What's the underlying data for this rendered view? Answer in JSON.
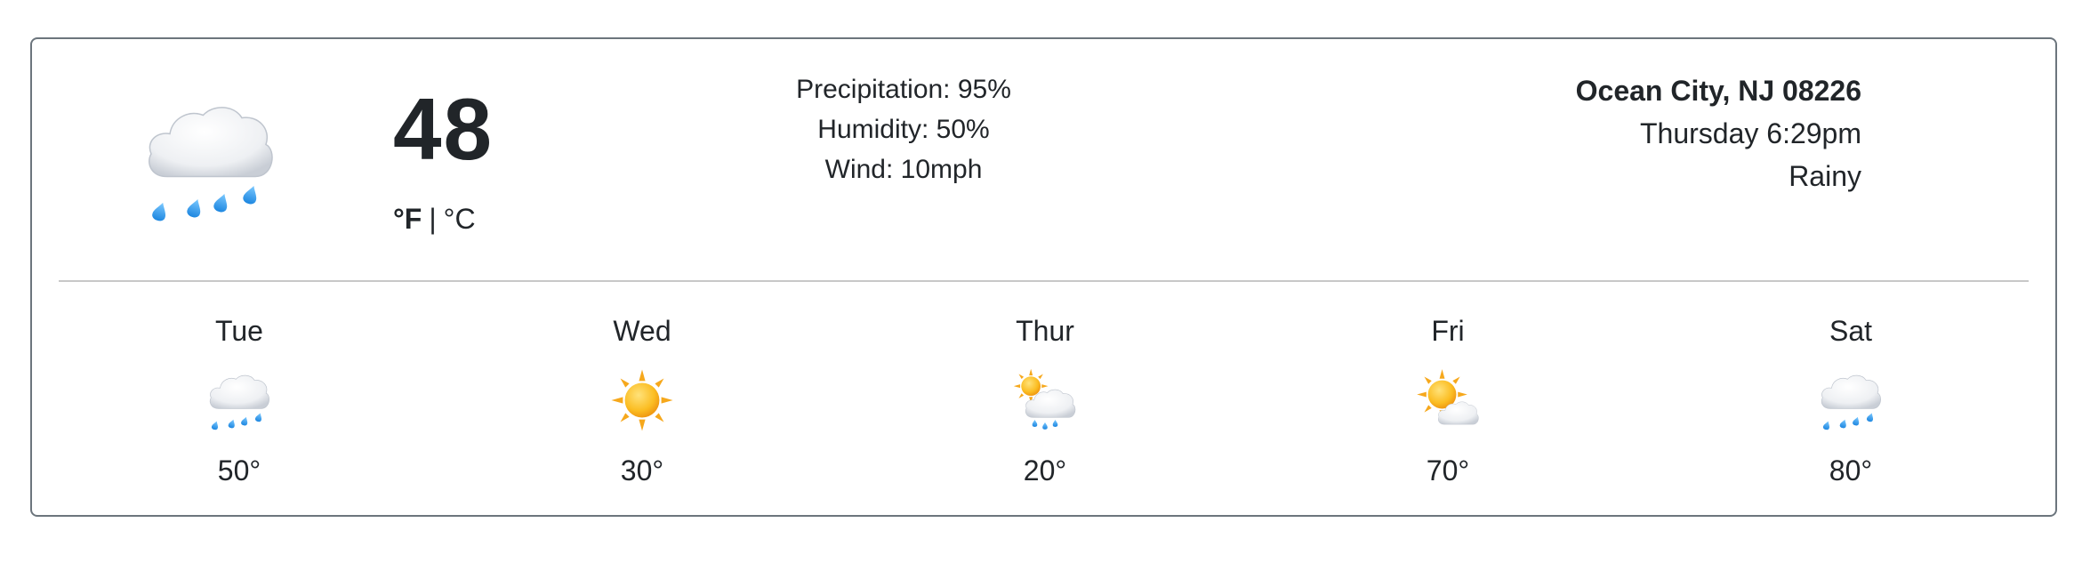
{
  "current": {
    "icon": "cloud-rain-icon",
    "temperature": "48",
    "unit_f": "°F",
    "unit_separator": "|",
    "unit_c": "°C",
    "precipitation": "Precipitation: 95%",
    "humidity": "Humidity: 50%",
    "wind": "Wind: 10mph",
    "location": "Ocean City, NJ 08226",
    "datetime": "Thursday 6:29pm",
    "condition": "Rainy"
  },
  "forecast": [
    {
      "day": "Tue",
      "icon": "cloud-rain-icon",
      "temp": "50°"
    },
    {
      "day": "Wed",
      "icon": "sun-icon",
      "temp": "30°"
    },
    {
      "day": "Thur",
      "icon": "sun-cloud-rain-icon",
      "temp": "20°"
    },
    {
      "day": "Fri",
      "icon": "sun-behind-cloud-icon",
      "temp": "70°"
    },
    {
      "day": "Sat",
      "icon": "cloud-rain-icon",
      "temp": "80°"
    }
  ],
  "colors": {
    "border": "#6c757d",
    "divider": "#c8c8c8",
    "text": "#212529",
    "sun": "#f7b924",
    "rain": "#2b9be8",
    "cloud": "#e6e9ee"
  }
}
